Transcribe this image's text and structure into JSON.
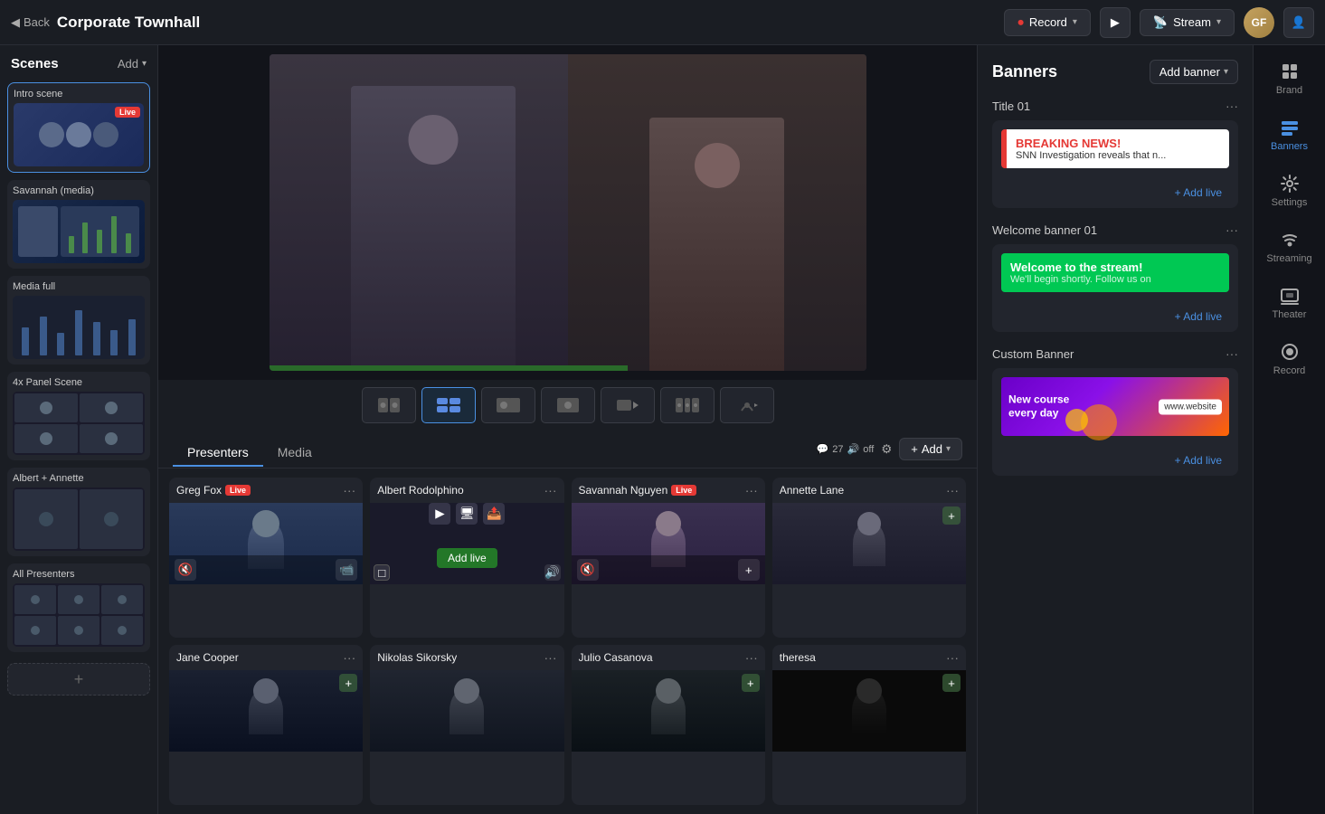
{
  "topbar": {
    "back_label": "Back",
    "title": "Corporate Townhall",
    "record_label": "Record",
    "stream_label": "Stream",
    "record_icon": "⏺",
    "stream_icon": "📡"
  },
  "scenes": {
    "title": "Scenes",
    "add_label": "Add",
    "items": [
      {
        "id": "intro",
        "label": "Intro scene",
        "live": true
      },
      {
        "id": "savannah",
        "label": "Savannah (media)",
        "live": false
      },
      {
        "id": "media_full",
        "label": "Media full",
        "live": false
      },
      {
        "id": "4x_panel",
        "label": "4x Panel Scene",
        "live": false
      },
      {
        "id": "albert_annette",
        "label": "Albert + Annette",
        "live": false
      },
      {
        "id": "all_presenters",
        "label": "All Presenters",
        "live": false
      }
    ]
  },
  "presenters_area": {
    "tab_presenters": "Presenters",
    "tab_media": "Media",
    "mic_status": "🎤 27 🔊 off",
    "add_label": "Add",
    "presenters": [
      {
        "name": "Greg Fox",
        "live": true,
        "has_video": true
      },
      {
        "name": "Albert Rodolphino",
        "live": false,
        "has_video": false,
        "add_live": true
      },
      {
        "name": "Savannah Nguyen",
        "live": true,
        "has_video": true
      },
      {
        "name": "Annette Lane",
        "live": false,
        "has_video": true
      },
      {
        "name": "Jane Cooper",
        "live": false,
        "has_video": true
      },
      {
        "name": "Nikolas Sikorsky",
        "live": false,
        "has_video": true
      },
      {
        "name": "Julio Casanova",
        "live": false,
        "has_video": true
      },
      {
        "name": "theresa",
        "live": false,
        "has_video": false
      }
    ]
  },
  "banners": {
    "title": "Banners",
    "add_banner_label": "Add banner",
    "sections": [
      {
        "title": "Title 01",
        "type": "breaking",
        "banner_title": "BREAKING NEWS!",
        "banner_subtitle": "SNN Investigation reveals that n...",
        "add_live_label": "+ Add live"
      },
      {
        "title": "Welcome banner 01",
        "type": "welcome",
        "banner_title": "Welcome to the stream!",
        "banner_subtitle": "We'll begin shortly. Follow us on",
        "add_live_label": "+ Add live"
      },
      {
        "title": "Custom Banner",
        "type": "custom",
        "banner_title": "New course every day",
        "banner_url": "www.website",
        "add_live_label": "+ Add live"
      }
    ]
  },
  "nav": {
    "items": [
      {
        "id": "brand",
        "label": "Brand",
        "icon": "🎨"
      },
      {
        "id": "banners",
        "label": "Banners",
        "icon": "📋",
        "active": true
      },
      {
        "id": "settings",
        "label": "Settings",
        "icon": "⚙️"
      },
      {
        "id": "streaming",
        "label": "Streaming",
        "icon": "📡"
      },
      {
        "id": "theater",
        "label": "Theater",
        "icon": "🎬"
      },
      {
        "id": "record",
        "label": "Record",
        "icon": "⏺"
      }
    ]
  }
}
